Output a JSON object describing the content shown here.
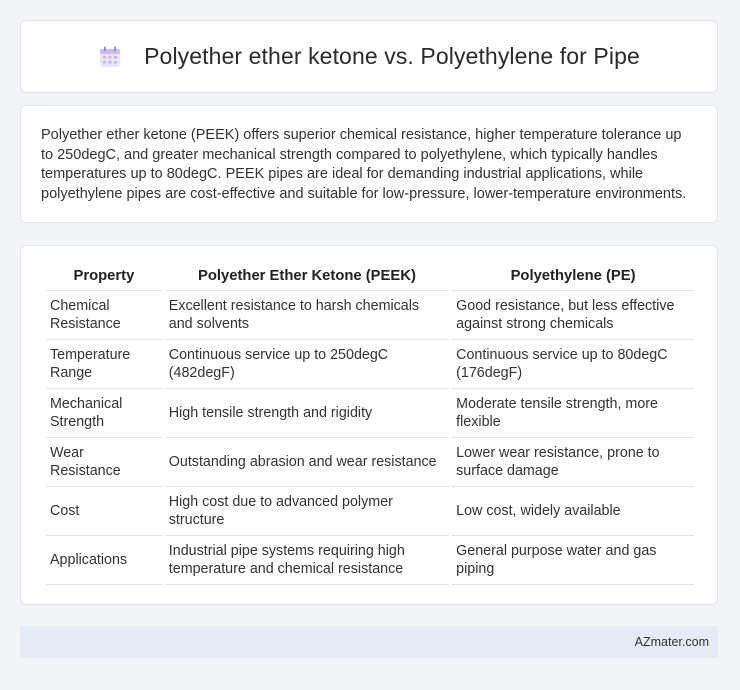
{
  "header": {
    "title": "Polyether ether ketone vs. Polyethylene for Pipe",
    "icon": "calendar-icon"
  },
  "summary": {
    "text": "Polyether ether ketone (PEEK) offers superior chemical resistance, higher temperature tolerance up to 250degC, and greater mechanical strength compared to polyethylene, which typically handles temperatures up to 80degC. PEEK pipes are ideal for demanding industrial applications, while polyethylene pipes are cost-effective and suitable for low-pressure, lower-temperature environments."
  },
  "table": {
    "headers": [
      "Property",
      "Polyether Ether Ketone (PEEK)",
      "Polyethylene (PE)"
    ],
    "rows": [
      [
        "Chemical Resistance",
        "Excellent resistance to harsh chemicals and solvents",
        "Good resistance, but less effective against strong chemicals"
      ],
      [
        "Temperature Range",
        "Continuous service up to 250degC (482degF)",
        "Continuous service up to 80degC (176degF)"
      ],
      [
        "Mechanical Strength",
        "High tensile strength and rigidity",
        "Moderate tensile strength, more flexible"
      ],
      [
        "Wear Resistance",
        "Outstanding abrasion and wear resistance",
        "Lower wear resistance, prone to surface damage"
      ],
      [
        "Cost",
        "High cost due to advanced polymer structure",
        "Low cost, widely available"
      ],
      [
        "Applications",
        "Industrial pipe systems requiring high temperature and chemical resistance",
        "General purpose water and gas piping"
      ]
    ]
  },
  "footer": {
    "brand": "AZmater.com"
  },
  "colors": {
    "page_background": "#f3f5f9",
    "card_background": "#ffffff",
    "footer_background": "#e6ecf6"
  }
}
